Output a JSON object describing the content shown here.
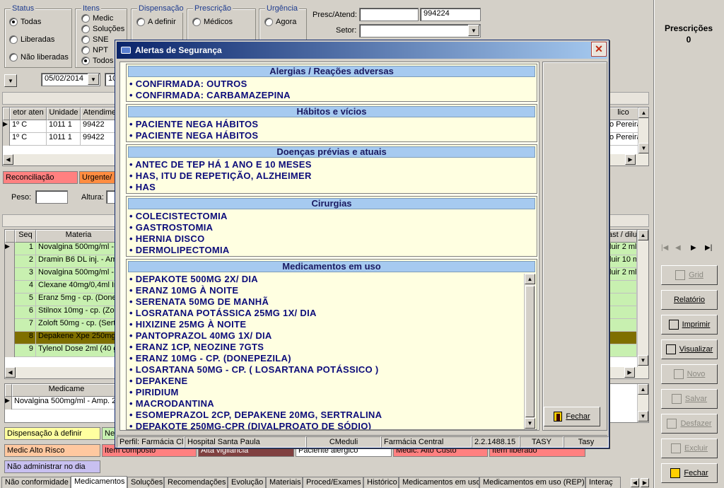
{
  "filters": {
    "status": {
      "title": "Status",
      "options": [
        "Todas",
        "Liberadas",
        "Não liberadas"
      ],
      "selected": 0
    },
    "itens": {
      "title": "Itens",
      "options": [
        "Medic",
        "Soluções",
        "SNE",
        "NPT",
        "Todos"
      ],
      "selected": 4
    },
    "dispensacao": {
      "title": "Dispensação",
      "options": [
        "A definir"
      ]
    },
    "prescricao": {
      "title": "Prescrição",
      "options": [
        "Médicos"
      ]
    },
    "urgencia": {
      "title": "Urgência",
      "options": [
        "Agora"
      ]
    },
    "presc_atend_label": "Presc/Atend:",
    "presc_atend_value": "994224",
    "setor_label": "Setor:",
    "date_value": "05/02/2014"
  },
  "right_panel": {
    "title": "Prescrições",
    "count": "0",
    "buttons": [
      {
        "label": "Grid",
        "enabled": false
      },
      {
        "label": "Relatório",
        "enabled": true
      },
      {
        "label": "Imprimir",
        "enabled": true
      },
      {
        "label": "Visualizar",
        "enabled": true
      },
      {
        "label": "Novo",
        "enabled": false
      },
      {
        "label": "Salvar",
        "enabled": false
      },
      {
        "label": "Desfazer",
        "enabled": false
      },
      {
        "label": "Excluir",
        "enabled": false
      },
      {
        "label": "Fechar",
        "enabled": true
      }
    ]
  },
  "top_grid": {
    "headers": [
      "etor aten",
      "Unidade",
      "Atendimen"
    ],
    "right_header": "lico",
    "rows": [
      {
        "setor": "1º C",
        "unidade": "1011 1",
        "atend": "99422",
        "right": "o Pereira"
      },
      {
        "setor": "1º C",
        "unidade": "1011 1",
        "atend": "99422",
        "right": "o Pereira"
      }
    ]
  },
  "tags_row": [
    "Reconciliação",
    "Urgente/"
  ],
  "peso_label": "Peso:",
  "altura_label": "Altura:",
  "items_grid": {
    "headers": [
      "Seq",
      "Materia"
    ],
    "right_header": "ast / dilu",
    "rows": [
      {
        "seq": "1",
        "material": "Novalgina 500mg/ml - A",
        "right": "luir 2 ml",
        "bg": "#c8f0b0"
      },
      {
        "seq": "2",
        "material": "Dramin B6 DL inj. - Amp",
        "right": "luir 10 m",
        "bg": "#c8f0b0"
      },
      {
        "seq": "3",
        "material": "Novalgina 500mg/ml - A",
        "right": "luir 2 ml",
        "bg": "#c8f0b0"
      },
      {
        "seq": "4",
        "material": "Clexane 40mg/0,4ml Inj",
        "right": "",
        "bg": "#c8f0b0"
      },
      {
        "seq": "5",
        "material": "Eranz 5mg - cp. (Donep",
        "right": "",
        "bg": "#c8f0b0"
      },
      {
        "seq": "6",
        "material": "Stilnox 10mg - cp. (Zolp",
        "right": "",
        "bg": "#c8f0b0"
      },
      {
        "seq": "7",
        "material": "Zoloft 50mg - cp. (Sertr",
        "right": "",
        "bg": "#c8f0b0"
      },
      {
        "seq": "8",
        "material": "Depakene Xpe 250mg",
        "right": "",
        "bg": "#7f6f00"
      },
      {
        "seq": "9",
        "material": "Tylenol Dose 2ml (40 g",
        "right": "",
        "bg": "#c8f0b0"
      }
    ]
  },
  "bottom_grid": {
    "header": "Medicame",
    "row": "Novalgina 500mg/ml - Amp. 2"
  },
  "legend": [
    {
      "label": "Dispensação à definir",
      "bg": "#ffffa0"
    },
    {
      "label": "Ne",
      "bg": "#c8f0b0"
    },
    {
      "label": "Medic Alto Risco",
      "bg": "#ffc8a0"
    },
    {
      "label": "Item composto",
      "bg": "#ff8080"
    },
    {
      "label": "Alta vigilância",
      "bg": "#804040"
    },
    {
      "label": "Paciente alérgico",
      "bg": "#ffffff"
    },
    {
      "label": "Medic. Alto Custo",
      "bg": "#ff8080"
    },
    {
      "label": "Item liberado",
      "bg": "#ff8080"
    },
    {
      "label": "Não administrar no dia",
      "bg": "#c8c0f0"
    }
  ],
  "tabs": [
    "Não conformidade",
    "Medicamentos",
    "Soluções",
    "Recomendações",
    "Evolução",
    "Materiais",
    "Proced/Exames",
    "Histórico",
    "Medicamentos em uso",
    "Medicamentos em uso (REP)",
    "Interaç"
  ],
  "active_tab": 1,
  "modal": {
    "title": "Alertas de Segurança",
    "sections": [
      {
        "title": "Alergias / Reações adversas",
        "items": [
          "CONFIRMADA:  OUTROS",
          "CONFIRMADA:  CARBAMAZEPINA"
        ]
      },
      {
        "title": "Hábitos e vícios",
        "items": [
          "PACIENTE NEGA HÁBITOS",
          "PACIENTE NEGA HÁBITOS"
        ]
      },
      {
        "title": "Doenças prévias e atuais",
        "items": [
          "ANTEC DE TEP HÁ 1 ANO E 10 MESES",
          "HAS, ITU DE REPETIÇÃO, ALZHEIMER",
          "HAS"
        ]
      },
      {
        "title": "Cirurgias",
        "items": [
          "COLECISTECTOMIA",
          "GASTROSTOMIA",
          "HERNIA DISCO",
          "DERMOLIPECTOMIA"
        ]
      },
      {
        "title": "Medicamentos em uso",
        "items": [
          "DEPAKOTE 500MG 2X/ DIA",
          "ERANZ 10MG À NOITE",
          "SERENATA 50MG DE MANHÃ",
          "LOSRATANA POTÁSSICA 25MG 1X/ DIA",
          "HIXIZINE 25MG À NOITE",
          "PANTOPRAZOL 40MG 1X/ DIA",
          "ERANZ 1CP, NEOZINE 7GTS",
          "ERANZ 10MG - CP. (DONEPEZILA)",
          "LOSARTANA 50MG - CP. ( LOSARTANA POTÁSSICO )",
          "DEPAKENE",
          "PIRIDIUM",
          "MACRODANTINA",
          "ESOMEPRAZOL 2CP, DEPAKENE  20MG, SERTRALINA",
          "DEPAKOTE  250MG-CPR  (DIVALPROATO DE SÓDIO)"
        ]
      }
    ],
    "close_button": "Fechar",
    "status": [
      "Perfil: Farmácia Clí",
      "Hospital Santa Paula",
      "CMeduli",
      "Farmácia Central",
      "2.2.1488.15",
      "TASY",
      "Tasy"
    ]
  }
}
